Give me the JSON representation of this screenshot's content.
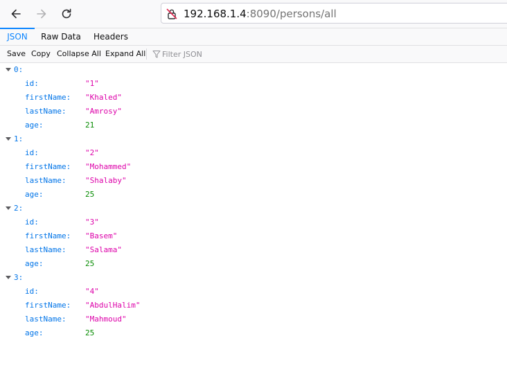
{
  "browser": {
    "url_host": "192.168.1.4",
    "url_rest": ":8090/persons/all"
  },
  "tabs": [
    {
      "label": "JSON",
      "active": true
    },
    {
      "label": "Raw Data",
      "active": false
    },
    {
      "label": "Headers",
      "active": false
    }
  ],
  "actions": {
    "save": "Save",
    "copy": "Copy",
    "collapse_all": "Collapse All",
    "expand_all": "Expand All",
    "filter_placeholder": "Filter JSON"
  },
  "records": [
    {
      "index": "0:",
      "id_key": "id:",
      "id": "\"1\"",
      "first_key": "firstName:",
      "first": "\"Khaled\"",
      "last_key": "lastName:",
      "last": "\"Amrosy\"",
      "age_key": "age:",
      "age": "21"
    },
    {
      "index": "1:",
      "id_key": "id:",
      "id": "\"2\"",
      "first_key": "firstName:",
      "first": "\"Mohammed\"",
      "last_key": "lastName:",
      "last": "\"Shalaby\"",
      "age_key": "age:",
      "age": "25"
    },
    {
      "index": "2:",
      "id_key": "id:",
      "id": "\"3\"",
      "first_key": "firstName:",
      "first": "\"Basem\"",
      "last_key": "lastName:",
      "last": "\"Salama\"",
      "age_key": "age:",
      "age": "25"
    },
    {
      "index": "3:",
      "id_key": "id:",
      "id": "\"4\"",
      "first_key": "firstName:",
      "first": "\"AbdulHalim\"",
      "last_key": "lastName:",
      "last": "\"Mahmoud\"",
      "age_key": "age:",
      "age": "25"
    }
  ],
  "colors": {
    "accent": "#0a84ff",
    "key": "#0074e8",
    "string": "#dd00a9",
    "number": "#058b00"
  }
}
